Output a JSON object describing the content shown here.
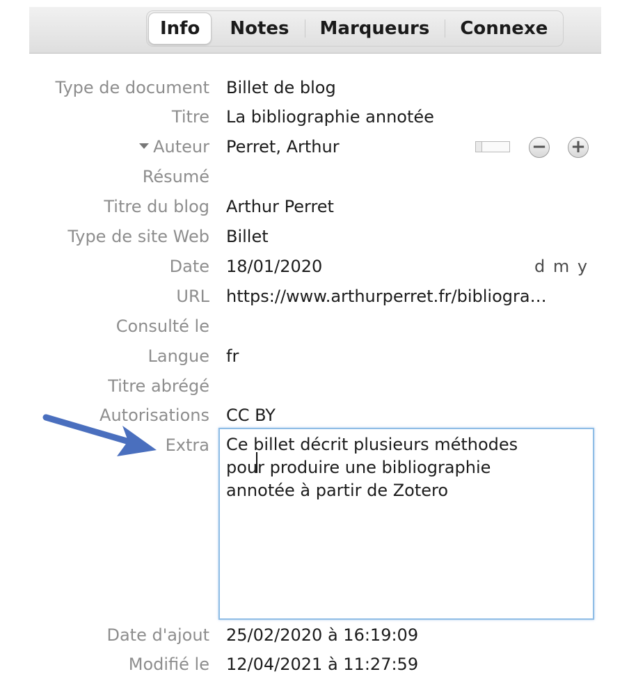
{
  "tabs": [
    {
      "label": "Info",
      "active": true
    },
    {
      "label": "Notes",
      "active": false
    },
    {
      "label": "Marqueurs",
      "active": false
    },
    {
      "label": "Connexe",
      "active": false
    }
  ],
  "fields": {
    "type_document": {
      "label": "Type de document",
      "value": "Billet de blog"
    },
    "titre": {
      "label": "Titre",
      "value": "La bibliographie annotée"
    },
    "auteur": {
      "label": "Auteur",
      "value": "Perret, Arthur"
    },
    "resume": {
      "label": "Résumé",
      "value": ""
    },
    "titre_blog": {
      "label": "Titre du blog",
      "value": "Arthur Perret"
    },
    "type_site": {
      "label": "Type de site Web",
      "value": "Billet"
    },
    "date": {
      "label": "Date",
      "value": "18/01/2020",
      "format": "d m y"
    },
    "url": {
      "label": "URL",
      "value": "https://www.arthurperret.fr/bibliogra…"
    },
    "consulte": {
      "label": "Consulté le",
      "value": ""
    },
    "langue": {
      "label": "Langue",
      "value": "fr"
    },
    "titre_abrege": {
      "label": "Titre abrégé",
      "value": ""
    },
    "autorisations": {
      "label": "Autorisations",
      "value": "CC BY"
    },
    "extra": {
      "label": "Extra",
      "value": "Ce billet décrit plusieurs méthodes\npour produire une bibliographie\nannotée à partir de Zotero"
    },
    "date_ajout": {
      "label": "Date d'ajout",
      "value": "25/02/2020 à 16:19:09"
    },
    "modifie": {
      "label": "Modifié le",
      "value": "12/04/2021 à 11:27:59"
    }
  },
  "buttons": {
    "minus": "−",
    "plus": "+"
  },
  "colors": {
    "focus_border": "#8fbde6",
    "arrow": "#4a6fbe",
    "label": "#8d8d8d"
  }
}
